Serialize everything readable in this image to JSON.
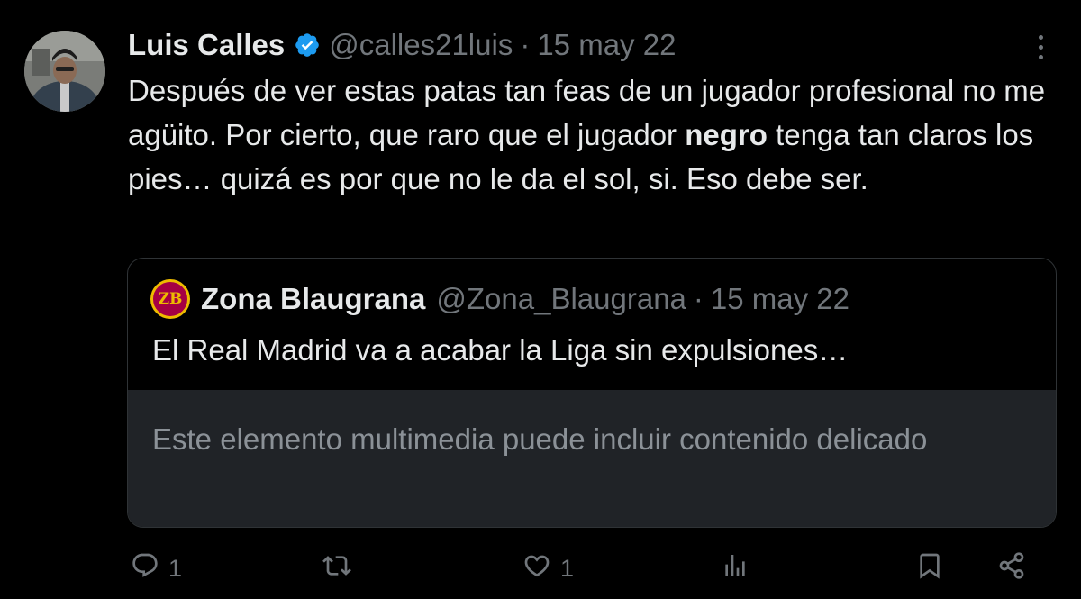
{
  "author": {
    "name": "Luis Calles",
    "handle": "@calles21luis",
    "separator": "·",
    "date": "15 may 22",
    "verified_icon": "verified-badge-icon",
    "verified_color": "#1d9bf0"
  },
  "tweet": {
    "text_before": "Después de ver estas patas tan feas de un jugador profesional no me agüito. Por cierto, que raro que el jugador ",
    "text_bold": "negro",
    "text_after": " tenga tan claros los pies… quizá es por que no le da el sol, si. Eso debe ser."
  },
  "quote": {
    "logo_text": "ZB",
    "name": "Zona Blaugrana",
    "handle": "@Zona_Blaugrana",
    "separator": "·",
    "date": "15 may 22",
    "text": "El Real Madrid va a acabar la Liga sin expulsiones…",
    "media_warning": "Este elemento multimedia puede incluir contenido delicado"
  },
  "actions": {
    "reply_count": "1",
    "retweet_count": "",
    "like_count": "1",
    "icons": [
      "reply-icon",
      "retweet-icon",
      "like-icon",
      "views-icon",
      "bookmark-icon",
      "share-icon"
    ]
  },
  "colors": {
    "background": "#000000",
    "text": "#e7e9ea",
    "muted": "#71767b",
    "accent": "#1d9bf0"
  }
}
